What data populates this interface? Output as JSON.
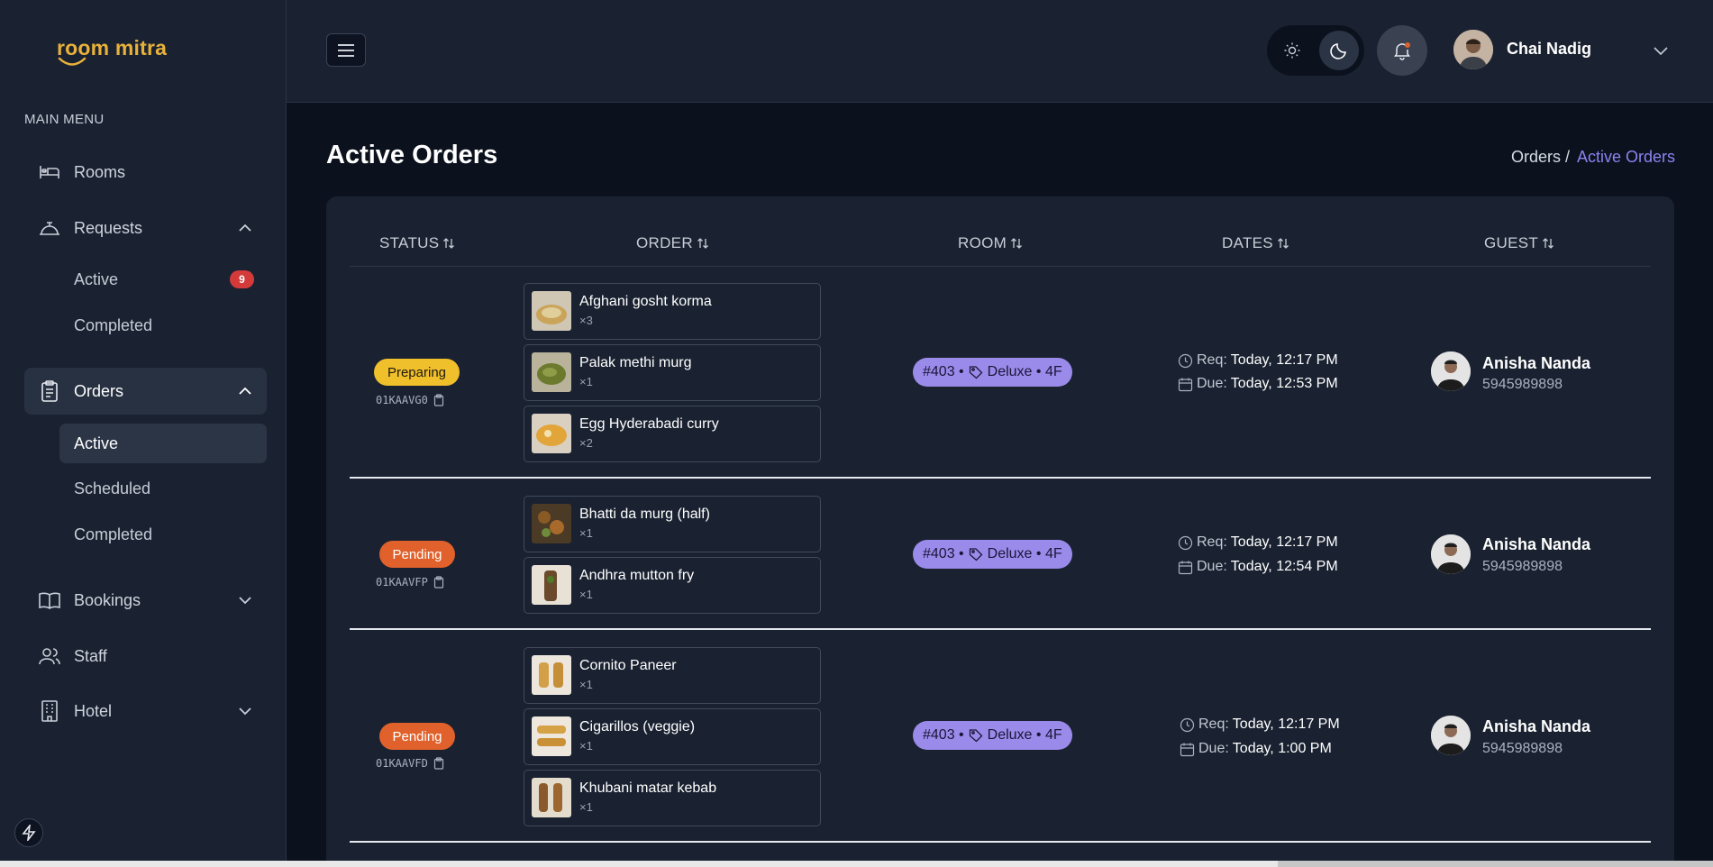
{
  "app": {
    "logo_text": "room mitra",
    "brand_color": "#e8b13a",
    "accent_color": "#8a84f0"
  },
  "sidebar": {
    "menu_heading": "MAIN MENU",
    "items": [
      {
        "label": "Rooms",
        "icon": "bed-icon"
      },
      {
        "label": "Requests",
        "icon": "service-bell-icon",
        "expanded": true,
        "children": [
          {
            "label": "Active",
            "badge": "9"
          },
          {
            "label": "Completed"
          }
        ]
      },
      {
        "label": "Orders",
        "icon": "clipboard-icon",
        "expanded": true,
        "active": true,
        "children": [
          {
            "label": "Active",
            "current": true
          },
          {
            "label": "Scheduled"
          },
          {
            "label": "Completed"
          }
        ]
      },
      {
        "label": "Bookings",
        "icon": "book-open-icon",
        "expanded": false
      },
      {
        "label": "Staff",
        "icon": "users-icon"
      },
      {
        "label": "Hotel",
        "icon": "building-icon",
        "expanded": false
      }
    ]
  },
  "header": {
    "user_name": "Chai Nadig",
    "theme": "dark"
  },
  "page": {
    "title": "Active Orders",
    "breadcrumb": {
      "parent": "Orders /",
      "current": "Active Orders"
    }
  },
  "table": {
    "columns": [
      "STATUS",
      "ORDER",
      "ROOM",
      "DATES",
      "GUEST"
    ],
    "rows": [
      {
        "status": "Preparing",
        "code": "01KAAVG0",
        "items": [
          {
            "name": "Afghani gosht korma",
            "qty": "×3"
          },
          {
            "name": "Palak methi murg",
            "qty": "×1"
          },
          {
            "name": "Egg Hyderabadi curry",
            "qty": "×2"
          }
        ],
        "room_number": "#403 •",
        "room_type": "Deluxe • 4F",
        "req_label": "Req:",
        "req_value": "Today, 12:17 PM",
        "due_label": "Due:",
        "due_value": "Today, 12:53 PM",
        "guest_name": "Anisha Nanda",
        "guest_phone": "5945989898"
      },
      {
        "status": "Pending",
        "code": "01KAAVFP",
        "items": [
          {
            "name": "Bhatti da murg (half)",
            "qty": "×1"
          },
          {
            "name": "Andhra mutton fry",
            "qty": "×1"
          }
        ],
        "room_number": "#403 •",
        "room_type": "Deluxe • 4F",
        "req_label": "Req:",
        "req_value": "Today, 12:17 PM",
        "due_label": "Due:",
        "due_value": "Today, 12:54 PM",
        "guest_name": "Anisha Nanda",
        "guest_phone": "5945989898"
      },
      {
        "status": "Pending",
        "code": "01KAAVFD",
        "items": [
          {
            "name": "Cornito Paneer",
            "qty": "×1"
          },
          {
            "name": "Cigarillos (veggie)",
            "qty": "×1"
          },
          {
            "name": "Khubani matar kebab",
            "qty": "×1"
          }
        ],
        "room_number": "#403 •",
        "room_type": "Deluxe • 4F",
        "req_label": "Req:",
        "req_value": "Today, 12:17 PM",
        "due_label": "Due:",
        "due_value": "Today, 1:00 PM",
        "guest_name": "Anisha Nanda",
        "guest_phone": "5945989898"
      }
    ]
  }
}
